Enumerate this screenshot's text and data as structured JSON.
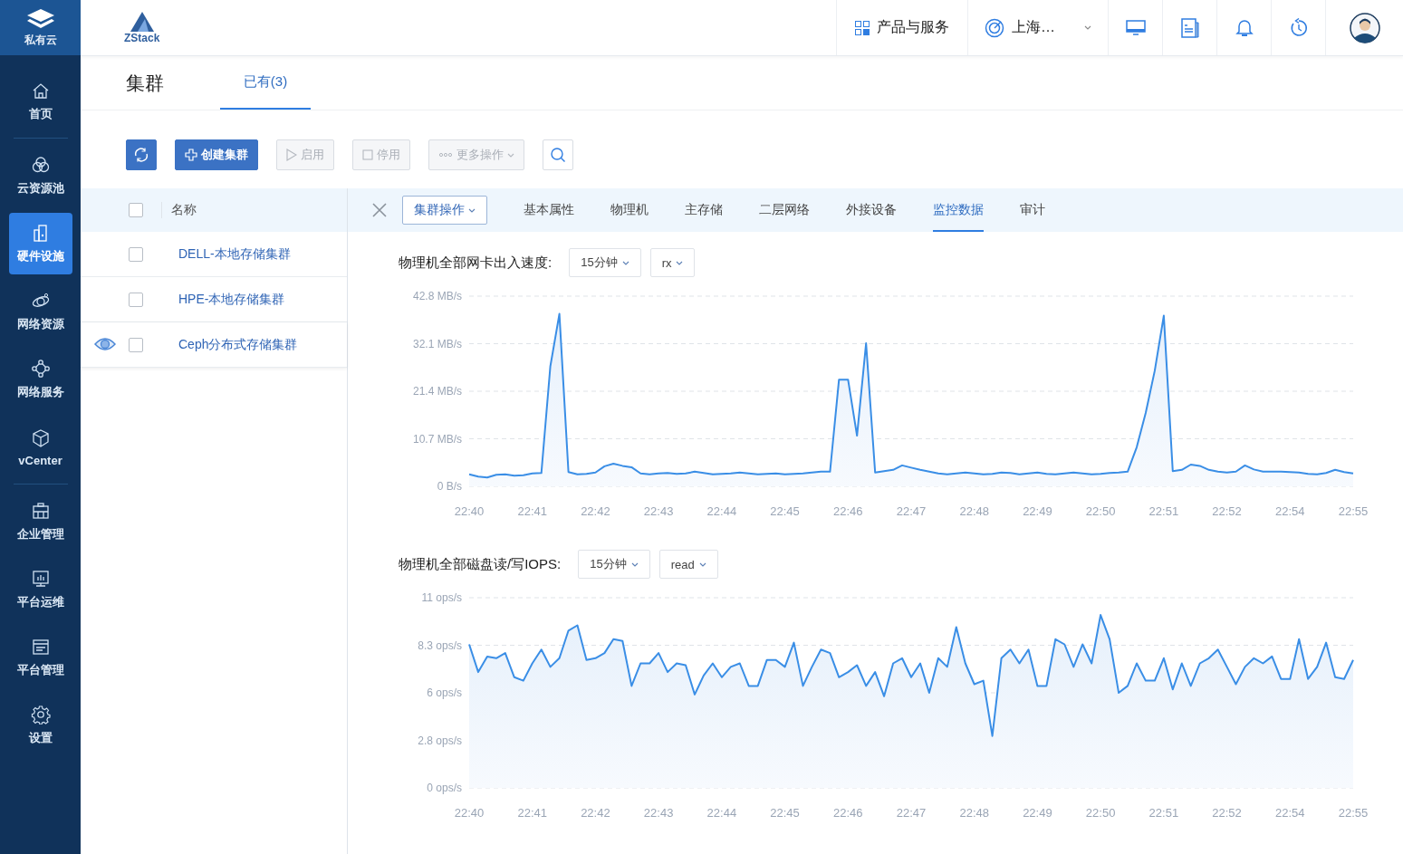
{
  "sidebar": {
    "brand": {
      "label": "私有云"
    },
    "items": [
      {
        "label": "首页",
        "selected": false
      },
      {
        "label": "云资源池",
        "selected": false
      },
      {
        "label": "硬件设施",
        "selected": true
      },
      {
        "label": "网络资源",
        "selected": false
      },
      {
        "label": "网络服务",
        "selected": false
      },
      {
        "label": "vCenter",
        "selected": false
      },
      {
        "label": "企业管理",
        "selected": false
      },
      {
        "label": "平台运维",
        "selected": false
      },
      {
        "label": "平台管理",
        "selected": false
      },
      {
        "label": "设置",
        "selected": false
      }
    ]
  },
  "topbar": {
    "logo": "ZStack",
    "products": "产品与服务",
    "region": "上海…"
  },
  "page": {
    "title": "集群",
    "tabs": [
      {
        "label": "已有(3)",
        "selected": true
      }
    ]
  },
  "toolbar": [
    {
      "kind": "refresh",
      "disabled": false
    },
    {
      "kind": "create",
      "label": "创建集群",
      "disabled": false
    },
    {
      "kind": "enable",
      "label": "启用",
      "disabled": true
    },
    {
      "kind": "disable",
      "label": "停用",
      "disabled": true
    },
    {
      "kind": "more",
      "label": "更多操作",
      "disabled": true
    },
    {
      "kind": "search"
    }
  ],
  "list": {
    "column": "名称",
    "header_checked": false,
    "rows": [
      {
        "name": "DELL-本地存储集群",
        "checked": false,
        "selected": false
      },
      {
        "name": "HPE-本地存储集群",
        "checked": false,
        "selected": false
      },
      {
        "name": "Ceph分布式存储集群",
        "checked": false,
        "selected": true
      }
    ]
  },
  "detail": {
    "actions": "集群操作",
    "tabs": [
      {
        "label": "基本属性",
        "selected": false
      },
      {
        "label": "物理机",
        "selected": false
      },
      {
        "label": "主存储",
        "selected": false
      },
      {
        "label": "二层网络",
        "selected": false
      },
      {
        "label": "外接设备",
        "selected": false
      },
      {
        "label": "监控数据",
        "selected": true
      },
      {
        "label": "审计",
        "selected": false
      }
    ],
    "panels": [
      {
        "title": "物理机全部网卡出入速度:",
        "selects": [
          "15分钟",
          "rx"
        ],
        "chart_data": {
          "type": "area",
          "grid": true,
          "ylim": [
            0,
            42.8
          ],
          "categories": [
            "22:40",
            null,
            null,
            null,
            null,
            null,
            null,
            "22:41",
            null,
            null,
            null,
            null,
            null,
            null,
            "22:42",
            null,
            null,
            null,
            null,
            null,
            null,
            "22:43",
            null,
            null,
            null,
            null,
            null,
            null,
            "22:44",
            null,
            null,
            null,
            null,
            null,
            null,
            "22:45",
            null,
            null,
            null,
            null,
            null,
            null,
            "22:46",
            null,
            null,
            null,
            null,
            null,
            null,
            "22:47",
            null,
            null,
            null,
            null,
            null,
            null,
            "22:48",
            null,
            null,
            null,
            null,
            null,
            null,
            "22:49",
            null,
            null,
            null,
            null,
            null,
            null,
            "22:50",
            null,
            null,
            null,
            null,
            null,
            null,
            "22:51",
            null,
            null,
            null,
            null,
            null,
            null,
            "22:52",
            null,
            null,
            null,
            null,
            null,
            null,
            "22:54",
            null,
            null,
            null,
            null,
            null,
            null,
            "22:55"
          ],
          "yticks": [
            {
              "value": 0,
              "label": "0 B/s"
            },
            {
              "value": 10.7,
              "label": "10.7 MB/s"
            },
            {
              "value": 21.4,
              "label": "21.4 MB/s"
            },
            {
              "value": 32.1,
              "label": "32.1 MB/s"
            },
            {
              "value": 42.8,
              "label": "42.8 MB/s"
            }
          ],
          "series": [
            {
              "color": "#3a8ee6",
              "values": [
                2.7,
                2.2,
                2.0,
                2.6,
                2.7,
                2.4,
                2.5,
                2.9,
                3.0,
                27,
                38.8,
                3.2,
                2.7,
                2.8,
                3.1,
                4.5,
                5.1,
                4.6,
                4.3,
                2.9,
                2.7,
                2.9,
                3.0,
                2.8,
                2.9,
                3.3,
                3.0,
                2.7,
                2.8,
                2.9,
                3.1,
                2.9,
                2.7,
                2.8,
                2.9,
                2.7,
                2.8,
                2.9,
                3.1,
                3.3,
                3.3,
                24,
                24,
                11.4,
                32.2,
                3.1,
                3.4,
                3.7,
                4.7,
                4.2,
                3.7,
                3.3,
                2.9,
                2.7,
                2.9,
                3.1,
                2.9,
                2.7,
                2.8,
                3.1,
                3.0,
                2.7,
                2.9,
                3.1,
                2.8,
                2.7,
                2.9,
                3.1,
                2.9,
                2.7,
                2.8,
                3.0,
                3.1,
                3.3,
                8.8,
                16.5,
                26,
                38.4,
                3.4,
                3.7,
                4.9,
                4.6,
                3.7,
                3.3,
                3.1,
                3.3,
                4.7,
                3.8,
                3.3,
                3.3,
                3.3,
                3.2,
                3.1,
                2.8,
                2.7,
                3.0,
                3.7,
                3.2,
                2.9
              ]
            }
          ]
        }
      },
      {
        "title": "物理机全部磁盘读/写IOPS:",
        "selects": [
          "15分钟",
          "read"
        ],
        "chart_data": {
          "type": "area",
          "grid": true,
          "ylim": [
            0,
            11
          ],
          "categories": [
            "22:40",
            null,
            null,
            null,
            null,
            null,
            null,
            "22:41",
            null,
            null,
            null,
            null,
            null,
            null,
            "22:42",
            null,
            null,
            null,
            null,
            null,
            null,
            "22:43",
            null,
            null,
            null,
            null,
            null,
            null,
            "22:44",
            null,
            null,
            null,
            null,
            null,
            null,
            "22:45",
            null,
            null,
            null,
            null,
            null,
            null,
            "22:46",
            null,
            null,
            null,
            null,
            null,
            null,
            "22:47",
            null,
            null,
            null,
            null,
            null,
            null,
            "22:48",
            null,
            null,
            null,
            null,
            null,
            null,
            "22:49",
            null,
            null,
            null,
            null,
            null,
            null,
            "22:50",
            null,
            null,
            null,
            null,
            null,
            null,
            "22:51",
            null,
            null,
            null,
            null,
            null,
            null,
            "22:52",
            null,
            null,
            null,
            null,
            null,
            null,
            "22:54",
            null,
            null,
            null,
            null,
            null,
            null,
            "22:55"
          ],
          "yticks": [
            {
              "value": 0,
              "label": "0 ops/s"
            },
            {
              "value": 2.75,
              "label": "2.8 ops/s"
            },
            {
              "value": 5.5,
              "label": "6 ops/s"
            },
            {
              "value": 8.25,
              "label": "8.3 ops/s"
            },
            {
              "value": 11,
              "label": "11 ops/s"
            }
          ],
          "series": [
            {
              "color": "#3a8ee6",
              "values": [
                8.3,
                6.7,
                7.6,
                7.5,
                7.8,
                6.4,
                6.2,
                7.2,
                8.0,
                7.0,
                7.5,
                9.1,
                9.4,
                7.4,
                7.5,
                7.8,
                8.6,
                8.5,
                5.9,
                7.2,
                7.2,
                7.8,
                6.7,
                7.2,
                7.1,
                5.4,
                6.5,
                7.2,
                6.4,
                7.0,
                7.2,
                5.9,
                5.9,
                7.4,
                7.4,
                7.0,
                8.4,
                5.9,
                7.0,
                8.0,
                7.8,
                6.4,
                6.7,
                7.1,
                5.9,
                6.7,
                5.3,
                7.2,
                7.5,
                6.4,
                7.2,
                5.5,
                7.5,
                7.0,
                9.3,
                7.2,
                6.0,
                6.2,
                3.0,
                7.5,
                8.0,
                7.2,
                8.0,
                5.9,
                5.9,
                8.6,
                8.3,
                7.0,
                8.3,
                7.2,
                10.0,
                8.6,
                5.5,
                5.9,
                7.2,
                6.2,
                6.2,
                7.5,
                5.7,
                7.2,
                5.9,
                7.2,
                7.5,
                8.0,
                7.0,
                6.0,
                7.0,
                7.5,
                7.2,
                7.6,
                6.3,
                6.3,
                8.6,
                6.3,
                7.0,
                8.4,
                6.4,
                6.3,
                7.4
              ]
            }
          ]
        }
      }
    ]
  }
}
